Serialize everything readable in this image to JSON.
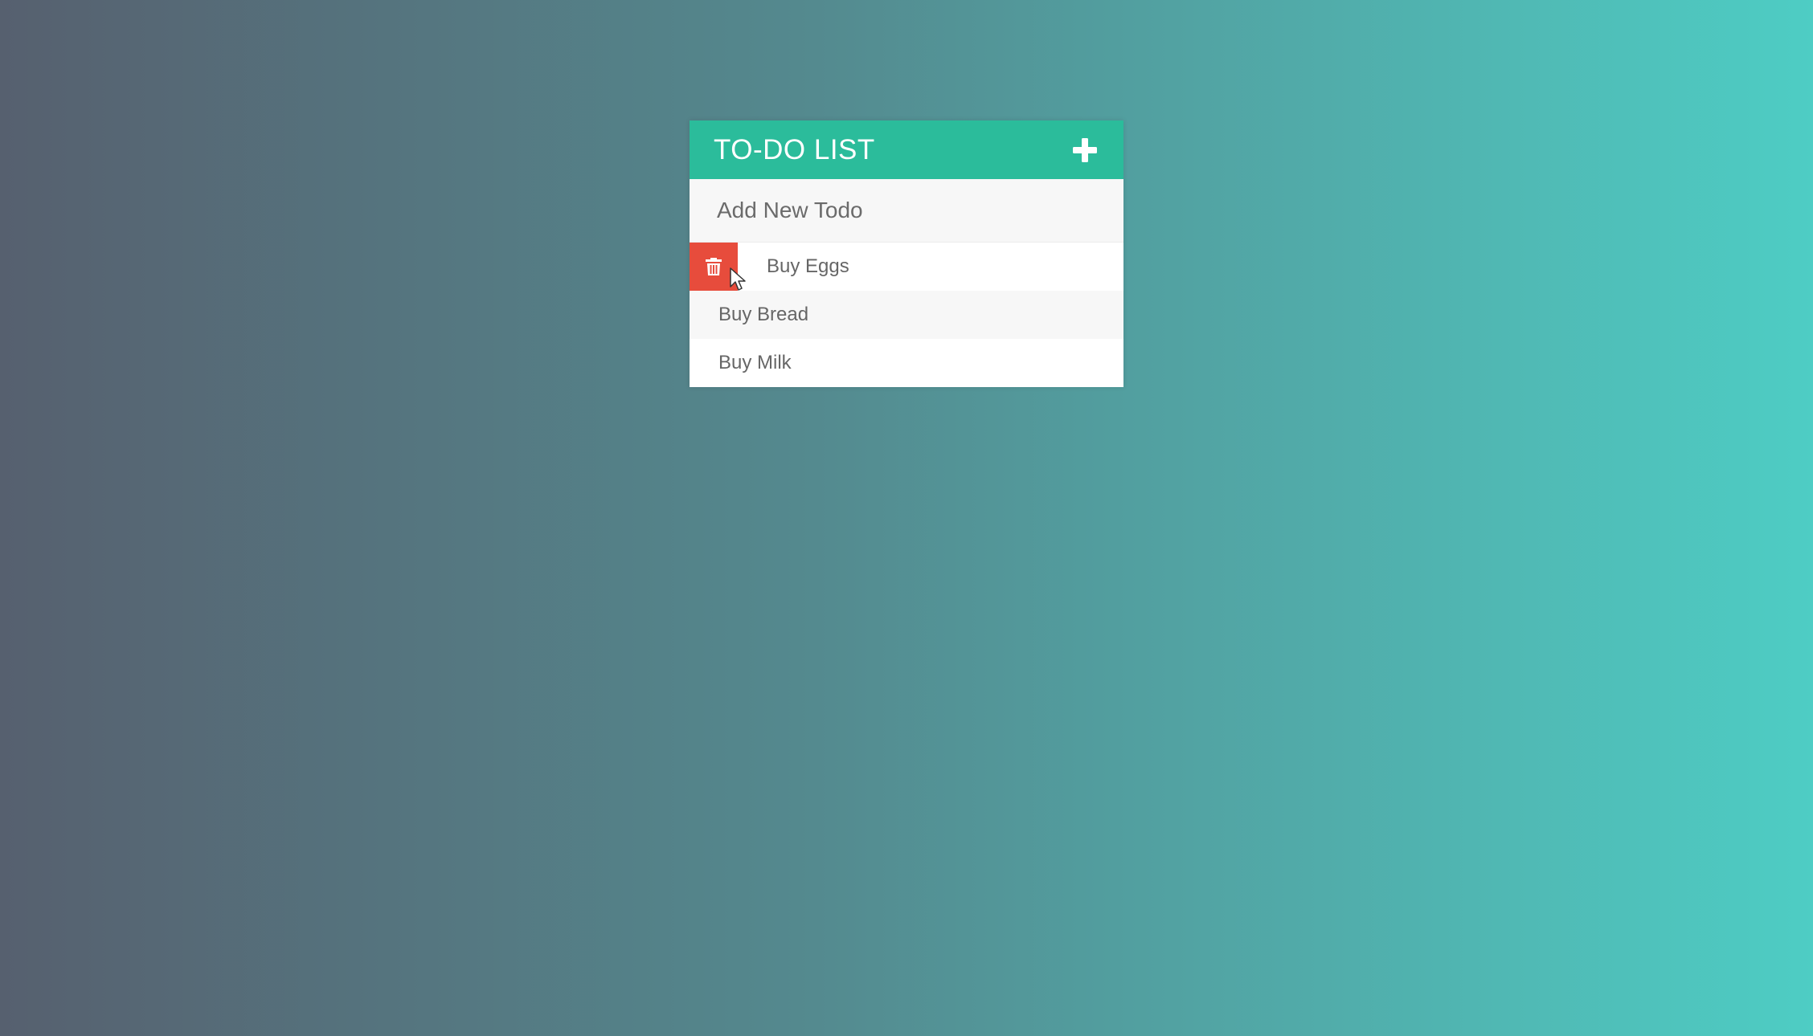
{
  "header": {
    "title": "TO-DO LIST",
    "add_icon": "plus-icon"
  },
  "new_todo": {
    "placeholder": "Add New Todo",
    "value": ""
  },
  "todos": [
    {
      "label": "Buy Eggs",
      "hovered": true,
      "delete_icon": "trash-icon"
    },
    {
      "label": "Buy Bread",
      "hovered": false
    },
    {
      "label": "Buy Milk",
      "hovered": false
    }
  ],
  "colors": {
    "header": "#2bbc9b",
    "delete": "#e74c3c",
    "text": "#666666",
    "background_start": "#56606f",
    "background_end": "#4ecdc4"
  }
}
